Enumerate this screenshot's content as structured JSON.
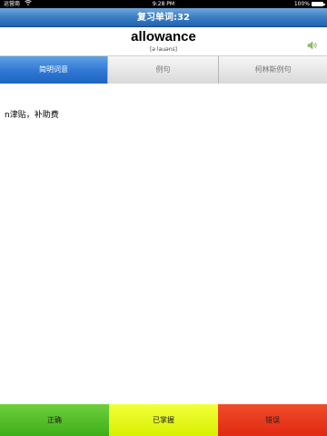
{
  "status_bar": {
    "carrier": "运营商",
    "time": "9:28 PM",
    "battery_percent": "100%",
    "battery_level": 1.0
  },
  "nav": {
    "title": "复习单词:32"
  },
  "word": {
    "text": "allowance",
    "phonetic": "[ə lauəns]",
    "speaker_icon": "speaker-icon"
  },
  "tabs": [
    {
      "label": "简明词意",
      "active": true
    },
    {
      "label": "例句",
      "active": false
    },
    {
      "label": "柯林斯例句",
      "active": false
    }
  ],
  "content": {
    "definition": "n津贴，补助费"
  },
  "bottom_buttons": {
    "correct": "正确",
    "mastered": "已掌握",
    "wrong": "错误"
  },
  "colors": {
    "nav_blue": "#3b7dc4",
    "tab_active_blue": "#2f77d3",
    "correct_green": "#4fbd26",
    "mastered_yellow": "#e6f81c",
    "wrong_red": "#e8391d"
  }
}
